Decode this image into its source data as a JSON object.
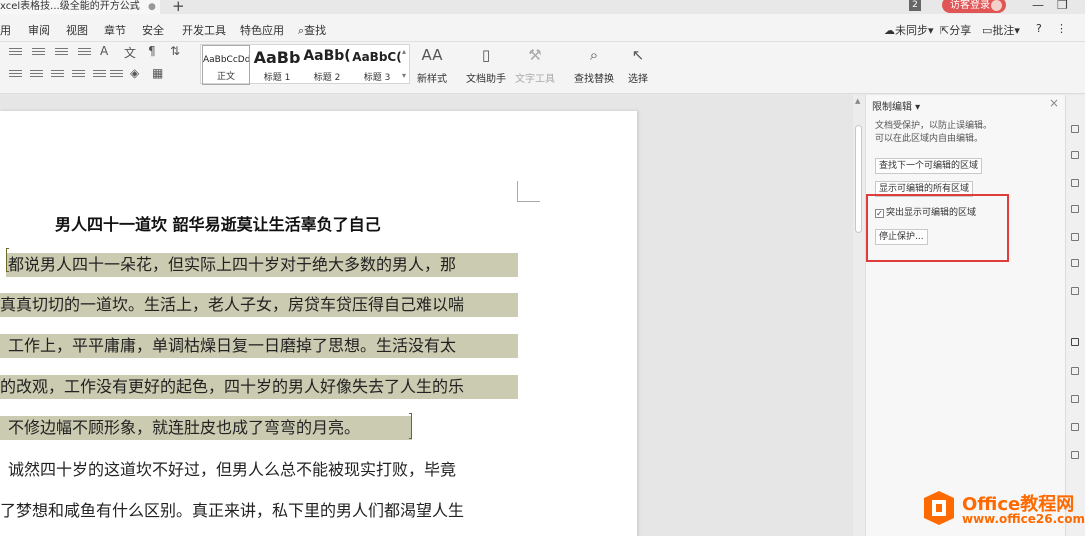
{
  "titlebar": {
    "doc_tab": "xcel表格技...级全能的开方公式",
    "new_tab": "+",
    "badge": "2",
    "login": "访客登录",
    "minimize": "—",
    "restore": "❐"
  },
  "menubar": {
    "items": [
      "用",
      "审阅",
      "视图",
      "章节",
      "安全",
      "开发工具",
      "特色应用"
    ],
    "search": "查找",
    "sync": "未同步",
    "share": "分享",
    "comment": "批注",
    "help": "?",
    "more": "⋮"
  },
  "toolbar": {
    "styles": [
      {
        "preview": "AaBbCcDd",
        "name": "正文"
      },
      {
        "preview": "AaBb",
        "name": "标题 1"
      },
      {
        "preview": "AaBb(",
        "name": "标题 2"
      },
      {
        "preview": "AaBbC(",
        "name": "标题 3"
      }
    ],
    "new_style": "新样式",
    "doc_helper": "文档助手",
    "text_tools": "文字工具",
    "find_replace": "查找替换",
    "select": "选择"
  },
  "document": {
    "title": "男人四十一道坎 韶华易逝莫让生活辜负了自己",
    "lines": [
      "都说男人四十一朵花，但实际上四十岁对于绝大多数的男人，那",
      "真真切切的一道坎。生活上，老人子女，房贷车贷压得自己难以喘",
      "工作上，平平庸庸，单调枯燥日复一日磨掉了思想。生活没有太",
      "的改观，工作没有更好的起色，四十岁的男人好像失去了人生的乐",
      "不修边幅不顾形象，就连肚皮也成了弯弯的月亮。",
      "诚然四十岁的这道坎不好过，但男人么总不能被现实打败，毕竟",
      "了梦想和咸鱼有什么区别。真正来讲，私下里的男人们都渴望人生"
    ]
  },
  "pane": {
    "title": "限制编辑",
    "desc_line1": "文档受保护，以防止误编辑。",
    "desc_line2": "可以在此区域内自由编辑。",
    "find_next": "查找下一个可编辑的区域",
    "show_all": "显示可编辑的所有区域",
    "highlight": "突出显示可编辑的区域",
    "highlight_checked": "✓",
    "stop": "停止保护...",
    "close": "×"
  },
  "watermark": {
    "brand": "Office教程网",
    "url": "www.office26.com"
  },
  "colors": {
    "highlight": "#cbcbb1",
    "red_frame": "#e03c3c",
    "brand": "#ff6a00",
    "login": "#e05656"
  }
}
